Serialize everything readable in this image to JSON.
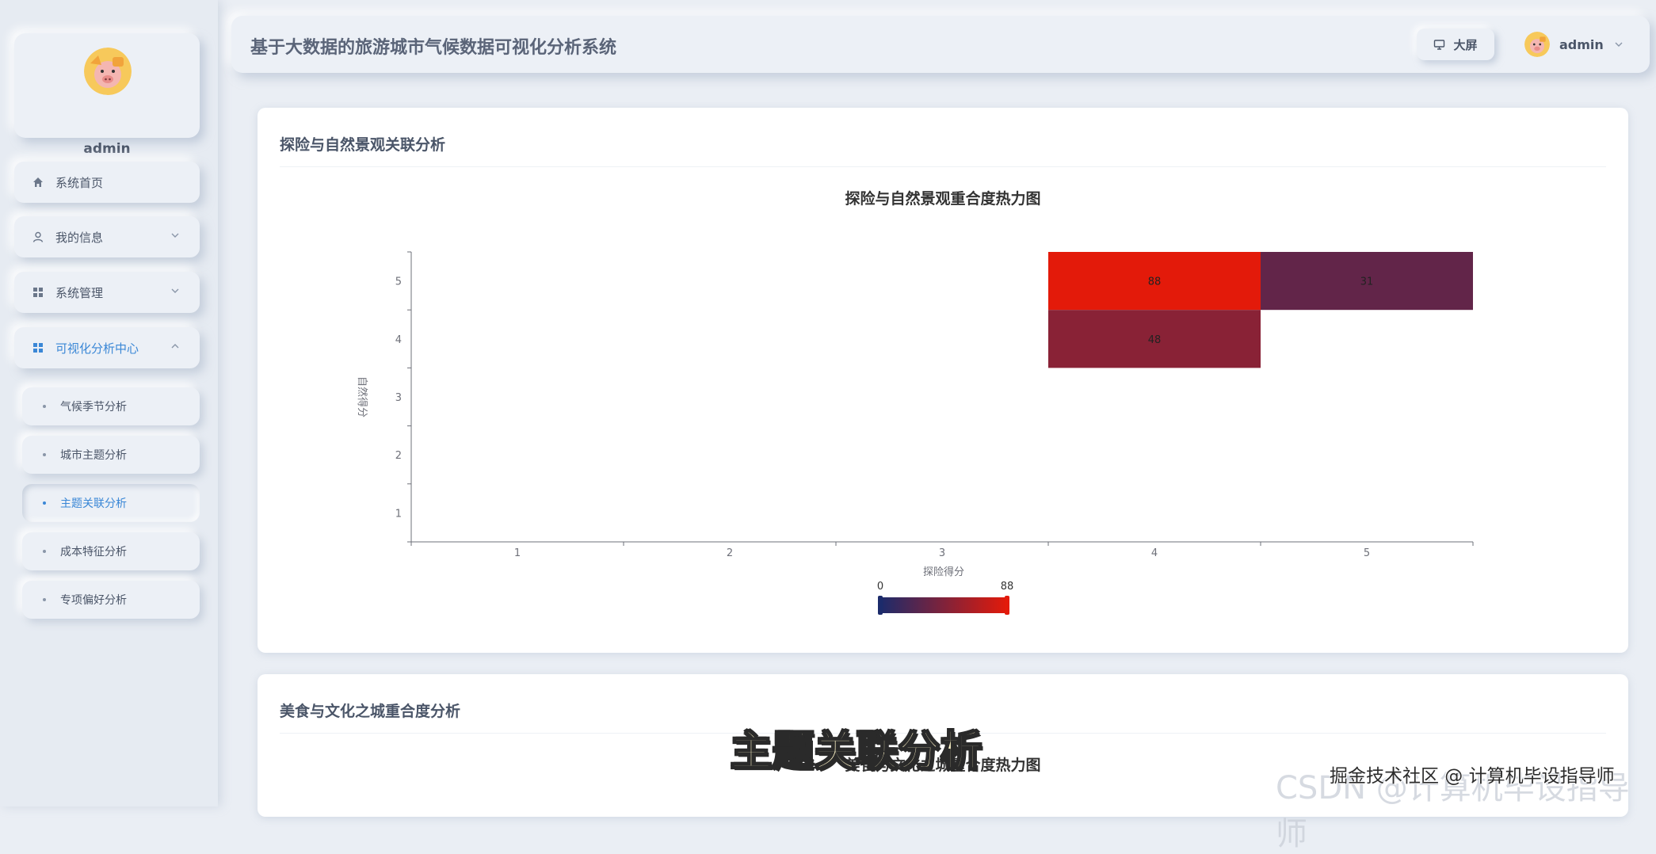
{
  "app": {
    "title": "基于大数据的旅游城市气候数据可视化分析系统",
    "big_screen_label": "大屏",
    "user_name": "admin"
  },
  "sidebar": {
    "profile_name": "admin",
    "menu": [
      {
        "label": "系统首页",
        "icon": "home-icon",
        "expandable": false
      },
      {
        "label": "我的信息",
        "icon": "user-icon",
        "expandable": true
      },
      {
        "label": "系统管理",
        "icon": "grid-icon",
        "expandable": true
      },
      {
        "label": "可视化分析中心",
        "icon": "grid-icon",
        "expandable": true,
        "expanded": true
      }
    ],
    "submenu": [
      {
        "label": "气候季节分析"
      },
      {
        "label": "城市主题分析"
      },
      {
        "label": "主题关联分析",
        "active": true
      },
      {
        "label": "成本特征分析"
      },
      {
        "label": "专项偏好分析"
      }
    ]
  },
  "panels": [
    {
      "title": "探险与自然景观关联分析",
      "chart_title": "探险与自然景观重合度热力图"
    },
    {
      "title": "美食与文化之城重合度分析",
      "chart_title": "美食与文化之城重合度热力图"
    }
  ],
  "chart_data": {
    "type": "heatmap",
    "title": "探险与自然景观重合度热力图",
    "xlabel": "探险得分",
    "ylabel": "自然得分",
    "x_categories": [
      "1",
      "2",
      "3",
      "4",
      "5"
    ],
    "y_categories": [
      "1",
      "2",
      "3",
      "4",
      "5"
    ],
    "cells": [
      {
        "x": "4",
        "y": "5",
        "value": 88
      },
      {
        "x": "5",
        "y": "5",
        "value": 31
      },
      {
        "x": "4",
        "y": "4",
        "value": 48
      }
    ],
    "visual_map": {
      "min": 0,
      "max": 88,
      "min_label": "0",
      "max_label": "88",
      "colors": [
        "#1c2b6b",
        "#e31a0a"
      ]
    }
  },
  "overlay": {
    "caption": "主题关联分析",
    "watermark_top": "掘金技术社区 @ 计算机毕设指导师",
    "watermark_bottom": "CSDN @计算机毕设指导师"
  },
  "colors": {
    "accent": "#3a87d6",
    "background": "#eaeef4"
  }
}
